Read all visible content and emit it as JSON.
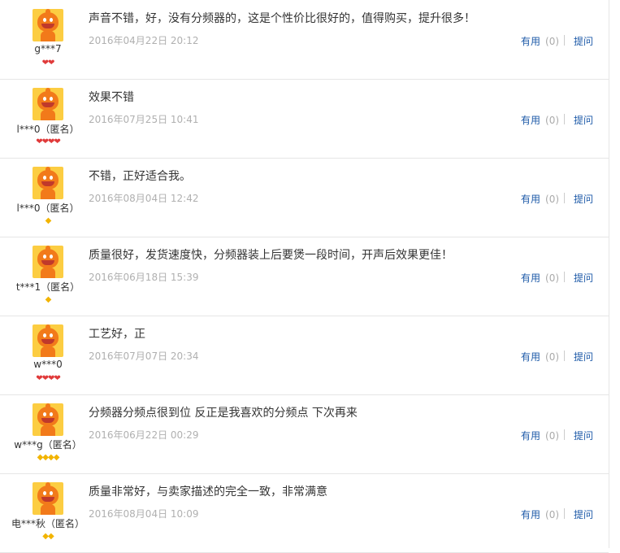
{
  "reviews": [
    {
      "user": "g***7",
      "content": "声音不错，好，没有分频器的，这是个性价比很好的，值得购买，提升很多！",
      "date": "2016年04月22日 20:12",
      "badge_type": "heart",
      "badge_count": 2,
      "useful_label": "有用",
      "useful_count": "(0)",
      "ask_label": "提问"
    },
    {
      "user": "l***0（匿名）",
      "content": "效果不错",
      "date": "2016年07月25日 10:41",
      "badge_type": "heart",
      "badge_count": 4,
      "useful_label": "有用",
      "useful_count": "(0)",
      "ask_label": "提问"
    },
    {
      "user": "l***0（匿名）",
      "content": "不错，正好适合我。",
      "date": "2016年08月04日 12:42",
      "badge_type": "diamond",
      "badge_count": 1,
      "useful_label": "有用",
      "useful_count": "(0)",
      "ask_label": "提问"
    },
    {
      "user": "t***1（匿名）",
      "content": "质量很好，发货速度快，分频器装上后要煲一段时间，开声后效果更佳！",
      "date": "2016年06月18日 15:39",
      "badge_type": "diamond",
      "badge_count": 1,
      "useful_label": "有用",
      "useful_count": "(0)",
      "ask_label": "提问"
    },
    {
      "user": "w***0",
      "content": "工艺好，正",
      "date": "2016年07月07日 20:34",
      "badge_type": "heart",
      "badge_count": 4,
      "useful_label": "有用",
      "useful_count": "(0)",
      "ask_label": "提问"
    },
    {
      "user": "w***g（匿名）",
      "content": "分频器分频点很到位 反正是我喜欢的分频点 下次再来",
      "date": "2016年06月22日 00:29",
      "badge_type": "diamond",
      "badge_count": 4,
      "useful_label": "有用",
      "useful_count": "(0)",
      "ask_label": "提问"
    },
    {
      "user": "电***秋（匿名）",
      "content": "质量非常好，与卖家描述的完全一致，非常满意",
      "date": "2016年08月04日 10:09",
      "badge_type": "diamond",
      "badge_count": 2,
      "useful_label": "有用",
      "useful_count": "(0)",
      "ask_label": "提问"
    }
  ],
  "icons": {
    "heart": "heart-icon",
    "diamond": "diamond-icon"
  },
  "colors": {
    "link": "#1d5aa8",
    "heart": "#e03a3a",
    "diamond": "#f2b400",
    "avatar_bg": "#fccd42",
    "avatar_face": "#f27a1a"
  }
}
